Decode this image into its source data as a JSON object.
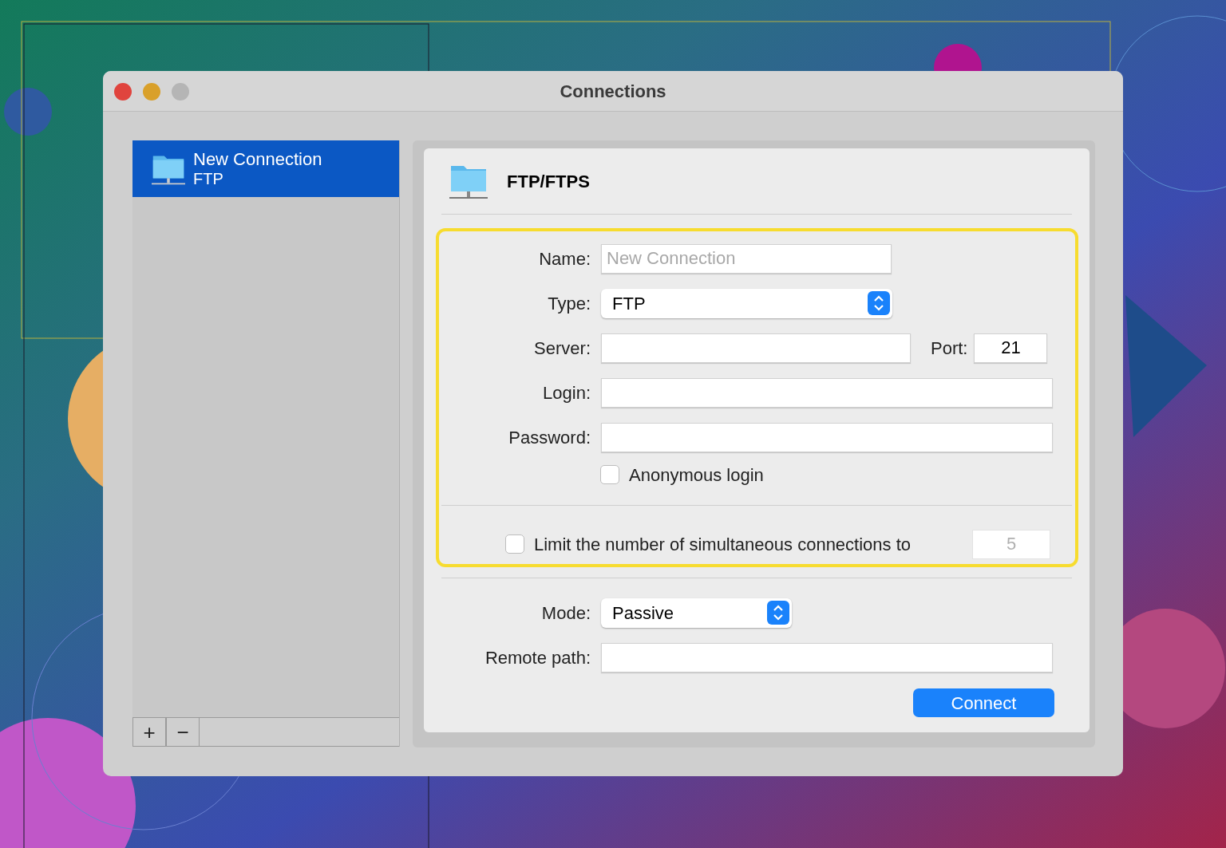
{
  "window": {
    "title": "Connections"
  },
  "sidebar": {
    "items": [
      {
        "title": "New Connection",
        "subtitle": "FTP",
        "selected": true
      }
    ],
    "buttons": [
      "+",
      "−"
    ]
  },
  "panel": {
    "title": "FTP/FTPS",
    "fields": [
      {
        "kind": "text",
        "label": "Name:",
        "placeholder": "New Connection"
      },
      {
        "kind": "select",
        "label": "Type:",
        "value": "FTP"
      },
      {
        "kind": "server",
        "label": "Server:",
        "port_label": "Port:",
        "port_value": "21"
      },
      {
        "kind": "text",
        "label": "Login:"
      },
      {
        "kind": "text",
        "label": "Password:"
      },
      {
        "kind": "checkbox",
        "label": "Anonymous login",
        "checked": false
      }
    ],
    "limit": {
      "label": "Limit the number of simultaneous connections to",
      "checked": false,
      "value": "5",
      "disabled": true
    },
    "fields2": [
      {
        "kind": "select",
        "label": "Mode:",
        "value": "Passive"
      },
      {
        "kind": "text",
        "label": "Remote path:"
      }
    ],
    "button": "Connect"
  }
}
